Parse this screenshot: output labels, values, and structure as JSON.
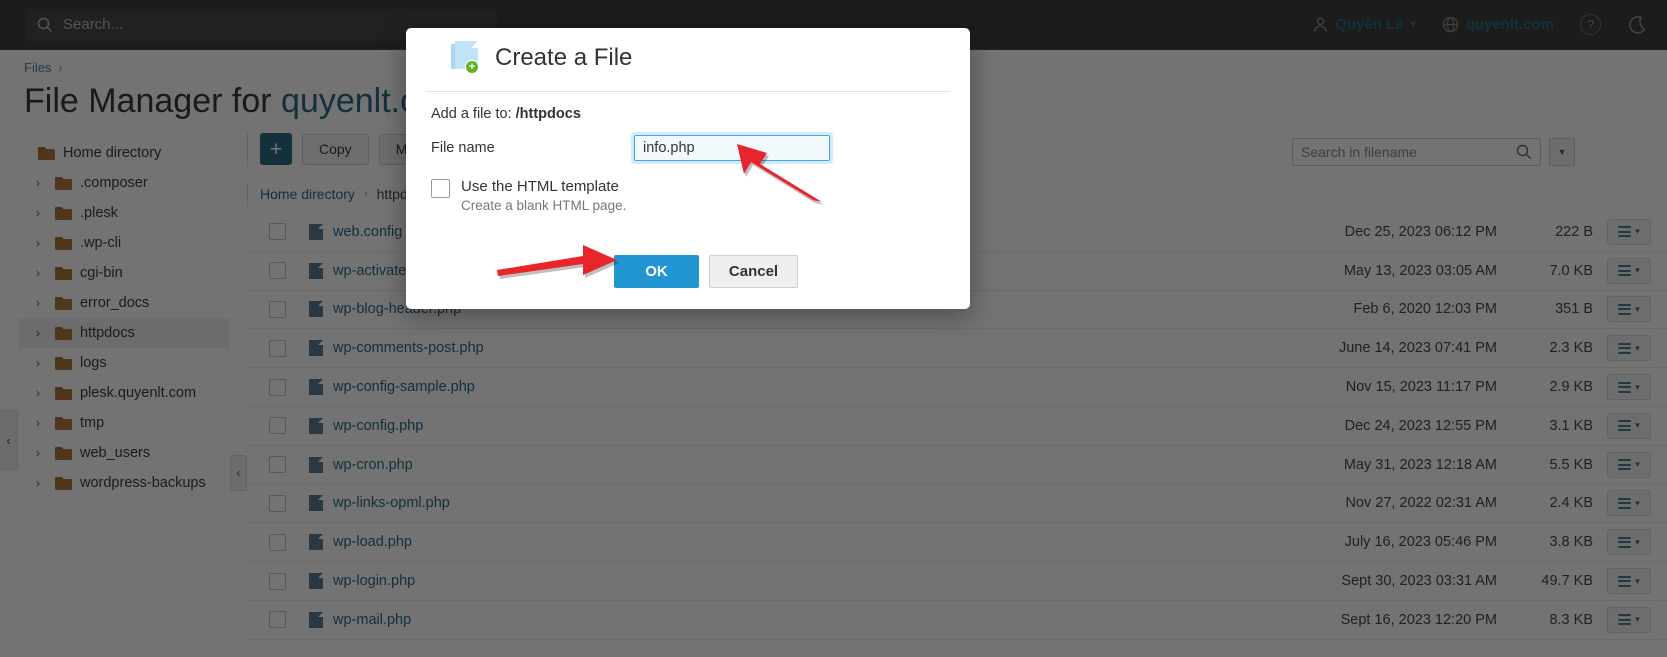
{
  "topbar": {
    "search_placeholder": "Search...",
    "search_icon": "search-icon",
    "user_name": "Quyền Lê",
    "user_icon": "person-icon",
    "user_chevron": "chevron-down-icon",
    "domain": "quyenlt.com",
    "domain_icon": "globe-icon",
    "help_label": "?",
    "help_icon": "help-circle-icon",
    "moon_icon": "moon-icon"
  },
  "breadcrumb": {
    "root": "Files",
    "separator": "›"
  },
  "page": {
    "title_prefix": "File Manager for ",
    "title_domain": "quyenlt.co"
  },
  "tree": {
    "root_label": "Home directory",
    "items": [
      {
        "label": ".composer",
        "selected": false
      },
      {
        "label": ".plesk",
        "selected": false
      },
      {
        "label": ".wp-cli",
        "selected": false
      },
      {
        "label": "cgi-bin",
        "selected": false
      },
      {
        "label": "error_docs",
        "selected": false
      },
      {
        "label": "httpdocs",
        "selected": true
      },
      {
        "label": "logs",
        "selected": false
      },
      {
        "label": "plesk.quyenlt.com",
        "selected": false
      },
      {
        "label": "tmp",
        "selected": false
      },
      {
        "label": "web_users",
        "selected": false
      },
      {
        "label": "wordpress-backups",
        "selected": false
      }
    ],
    "collapse_icon": "chevron-left-icon",
    "expand_icon": "chevron-right-icon"
  },
  "toolbar": {
    "add_label": "+",
    "copy_label": "Copy",
    "move_label": "Move"
  },
  "subcrumbs": {
    "home": "Home directory",
    "separator": "›",
    "current": "httpdocs"
  },
  "file_search": {
    "placeholder": "Search in filename",
    "icon": "search-icon",
    "more_icon": "chevron-down-icon"
  },
  "files": [
    {
      "name": "web.config",
      "date": "Dec 25, 2023 06:12 PM",
      "size": "222 B"
    },
    {
      "name": "wp-activate.php",
      "date": "May 13, 2023 03:05 AM",
      "size": "7.0 KB"
    },
    {
      "name": "wp-blog-header.php",
      "date": "Feb 6, 2020 12:03 PM",
      "size": "351 B"
    },
    {
      "name": "wp-comments-post.php",
      "date": "June 14, 2023 07:41 PM",
      "size": "2.3 KB"
    },
    {
      "name": "wp-config-sample.php",
      "date": "Nov 15, 2023 11:17 PM",
      "size": "2.9 KB"
    },
    {
      "name": "wp-config.php",
      "date": "Dec 24, 2023 12:55 PM",
      "size": "3.1 KB"
    },
    {
      "name": "wp-cron.php",
      "date": "May 31, 2023 12:18 AM",
      "size": "5.5 KB"
    },
    {
      "name": "wp-links-opml.php",
      "date": "Nov 27, 2022 02:31 AM",
      "size": "2.4 KB"
    },
    {
      "name": "wp-load.php",
      "date": "July 16, 2023 05:46 PM",
      "size": "3.8 KB"
    },
    {
      "name": "wp-login.php",
      "date": "Sept 30, 2023 03:31 AM",
      "size": "49.7 KB"
    },
    {
      "name": "wp-mail.php",
      "date": "Sept 16, 2023 12:20 PM",
      "size": "8.3 KB"
    }
  ],
  "row_action_icon": "hamburger-menu-icon",
  "row_action_chevron": "chevron-down-icon",
  "modal": {
    "title": "Create a File",
    "icon": "new-file-icon",
    "add_to_label": "Add a file to: ",
    "add_to_path": "/httpdocs",
    "file_name_label": "File name",
    "file_name_value": "info.php",
    "file_name_placeholder": "",
    "checkbox_label": "Use the HTML template",
    "checkbox_hint": "Create a blank HTML page.",
    "checkbox_checked": false,
    "ok_label": "OK",
    "cancel_label": "Cancel"
  },
  "annotations": {
    "arrow_color": "#e8252a",
    "arrow_to_input": "arrow-pointing-to-file-name-input",
    "arrow_to_ok": "arrow-pointing-to-ok-button"
  },
  "colors": {
    "accent_blue": "#2196d3",
    "link_blue": "#2d6c87",
    "topbar_bg": "#3f3f3f",
    "folder": "#b07a3f",
    "green_badge": "#5fb226"
  }
}
